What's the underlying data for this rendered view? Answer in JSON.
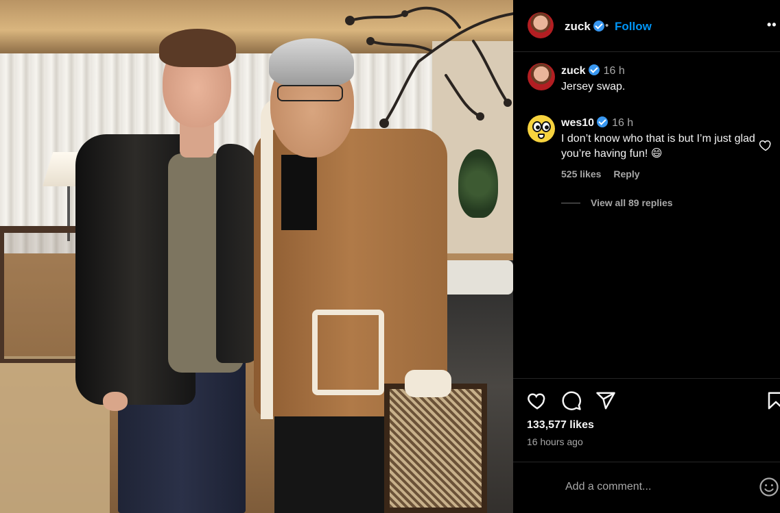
{
  "post": {
    "photo_alt": "Two men posing in a dining room",
    "author": "zuck",
    "follow_label": "Follow",
    "separator": "•",
    "more_label": "••",
    "likes": "133,577 likes",
    "posted": "16 hours ago",
    "add_comment_placeholder": "Add a comment..."
  },
  "comments": [
    {
      "user": "zuck",
      "time": "16 h",
      "text": "Jersey swap."
    },
    {
      "user": "wes10",
      "time": "16 h",
      "text": "I don’t know who that is but I’m just glad you’re having fun! 😄",
      "likes": "525 likes",
      "reply_label": "Reply",
      "view_replies": "View all 89 replies"
    }
  ],
  "icons": {
    "like": "heart-icon",
    "comment": "comment-bubble-icon",
    "share": "paper-plane-icon",
    "save": "bookmark-icon",
    "emoji": "smiley-icon",
    "verified": "verified-badge-icon"
  },
  "colors": {
    "background": "#000000",
    "accent": "#0095f6",
    "verified": "#3897f0",
    "muted_text": "#a8a8a8",
    "divider": "#262626"
  }
}
